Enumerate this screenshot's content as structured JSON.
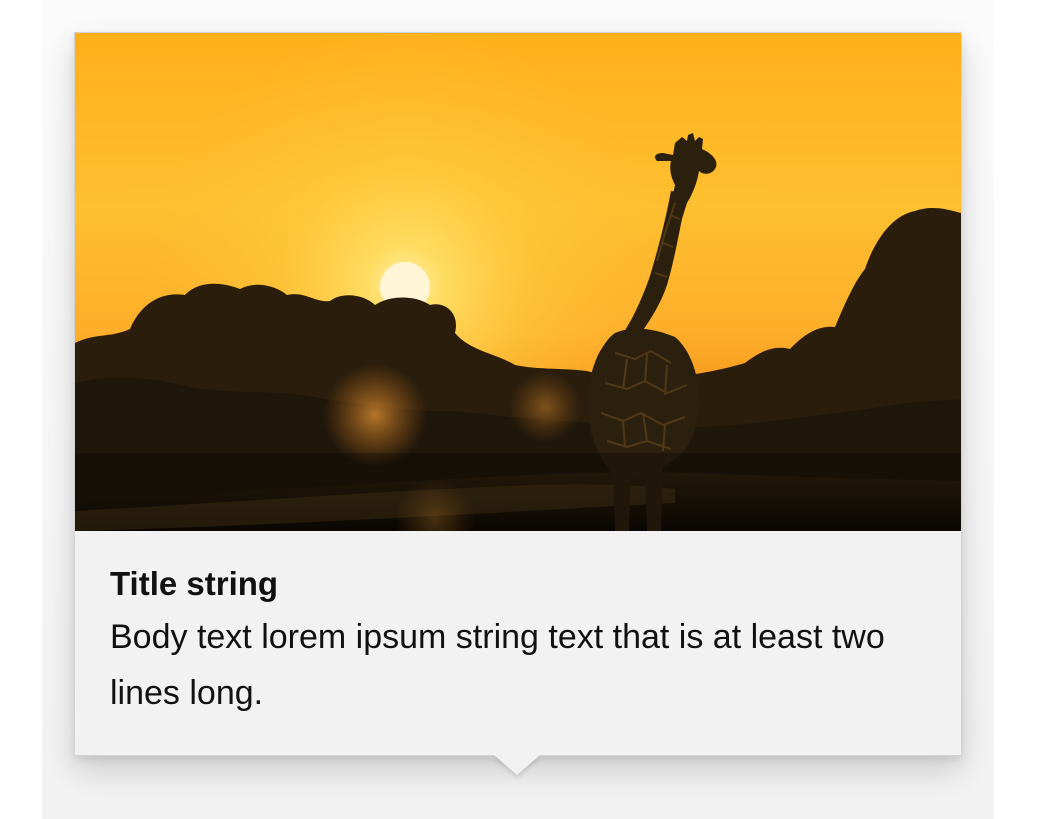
{
  "teaching_tip": {
    "hero_image": {
      "icon": "giraffe-sunset-image",
      "sky_top": "#ffb218",
      "sky_mid": "#ffc53a",
      "horizon": "#f7961a",
      "sun": "#fff6d8",
      "silhouette": "#1c1408"
    },
    "title": "Title string",
    "body": "Body text lorem ipsum string text that is at least two lines long."
  }
}
